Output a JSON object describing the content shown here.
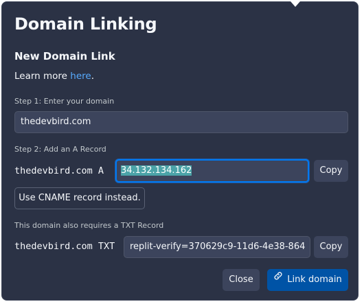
{
  "dialog": {
    "title": "Domain Linking",
    "subtitle": "New Domain Link",
    "learn_more_text": "Learn more ",
    "learn_more_link": "here",
    "learn_more_period": "."
  },
  "step1": {
    "label": "Step 1: Enter your domain",
    "domain_value": "thedevbird.com"
  },
  "step2": {
    "label": "Step 2: Add an A Record",
    "record_name": "thedevbird.com A",
    "a_value": "34.132.134.162",
    "copy_label": "Copy",
    "cname_button_label": "Use CNAME record instead."
  },
  "txt": {
    "label": "This domain also requires a TXT Record",
    "record_name": "thedevbird.com TXT",
    "txt_value": "replit-verify=370629c9-11d6-4e38-864",
    "copy_label": "Copy"
  },
  "footer": {
    "close_label": "Close",
    "link_label": "Link domain"
  },
  "icons": {
    "link_button_icon": "link-icon"
  },
  "colors": {
    "background": "#2b3245",
    "input_bg": "#3c445c",
    "accent": "#0079f2",
    "primary_button": "#0053a6",
    "link": "#57abff"
  }
}
